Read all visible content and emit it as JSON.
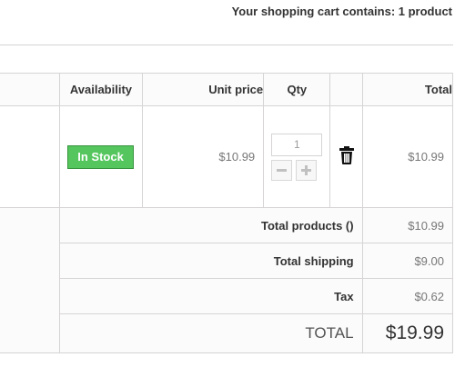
{
  "cart": {
    "summary": "Your shopping cart contains: 1 product"
  },
  "table": {
    "headers": {
      "description": "",
      "availability": "Availability",
      "unit_price": "Unit price",
      "qty": "Qty",
      "delete": "",
      "total": "Total"
    },
    "item": {
      "availability": "In Stock",
      "availability_color": "#55c65e",
      "unit_price": "$10.99",
      "qty": "1",
      "qty_decrease_icon": "minus-icon",
      "qty_increase_icon": "plus-icon",
      "delete_icon": "trash-icon",
      "total": "$10.99"
    },
    "footer": {
      "total_products_label": "Total products ()",
      "total_products_value": "$10.99",
      "total_shipping_label": "Total shipping",
      "total_shipping_value": "$9.00",
      "tax_label": "Tax",
      "tax_value": "$0.62",
      "grand_total_label": "TOTAL",
      "grand_total_value": "$19.99"
    }
  }
}
